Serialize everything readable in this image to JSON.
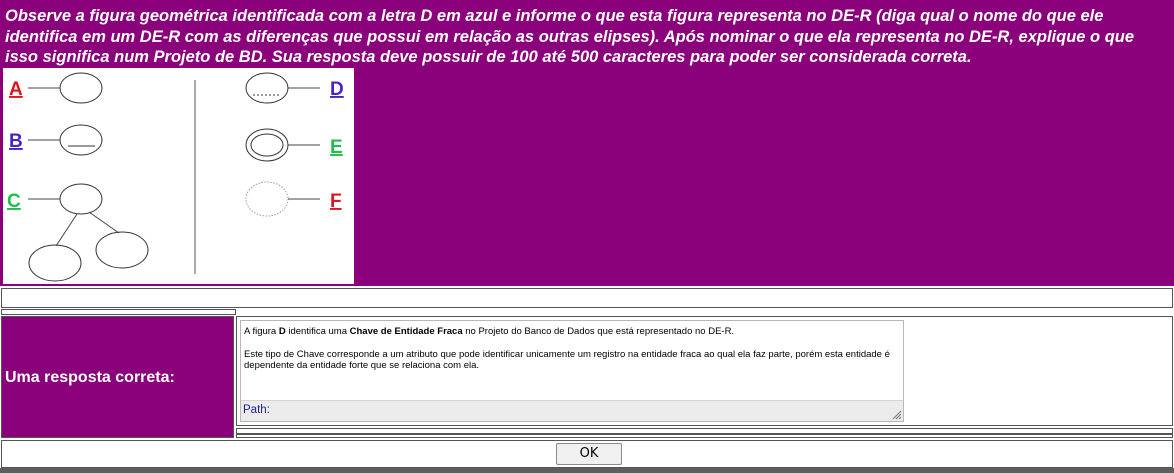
{
  "question": {
    "text": "Observe a figura geométrica identificada com a letra D em azul e informe o que esta figura representa no DE-R (diga qual o nome do que ele identifica em um DE-R com as diferenças que possui em relação as outras elipses). Após nominar o que ela representa no DE-R, explique o que isso significa num Projeto de BD. Sua resposta deve possuir de 100 até 500 caracteres para poder ser considerada correta."
  },
  "figure": {
    "labels": [
      {
        "letter": "A",
        "color": "#e0141c"
      },
      {
        "letter": "B",
        "color": "#4a23c8"
      },
      {
        "letter": "C",
        "color": "#1fbf4c"
      },
      {
        "letter": "D",
        "color": "#4a23c8"
      },
      {
        "letter": "E",
        "color": "#1fbf4c"
      },
      {
        "letter": "F",
        "color": "#e0141c"
      }
    ]
  },
  "answer": {
    "label": "Uma resposta correta:",
    "p1_before": "A figura ",
    "p1_bold1": "D",
    "p1_mid": " identifica uma ",
    "p1_bold2": "Chave de Entidade Fraca",
    "p1_after": " no Projeto do Banco de Dados que está representado no DE-R.",
    "p2": "Este tipo de Chave corresponde a um atributo que pode identificar unicamente um registro na entidade fraca ao qual ela faz parte, porém esta entidade é dependente da entidade forte que se relaciona com ela.",
    "path_label": "Path:"
  },
  "ok_label": "OK",
  "colors": {
    "header_bg": "#8b007b",
    "header_text": "#ffffff"
  }
}
